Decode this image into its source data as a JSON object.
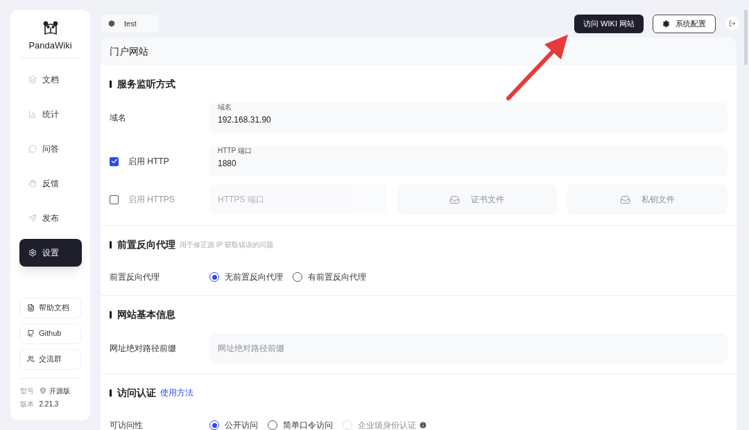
{
  "sidebar": {
    "logo": "PandaWiki",
    "nav": [
      {
        "label": "文档",
        "selected": false
      },
      {
        "label": "统计",
        "selected": false
      },
      {
        "label": "问答",
        "selected": false
      },
      {
        "label": "反馈",
        "selected": false
      },
      {
        "label": "发布",
        "selected": false
      },
      {
        "label": "设置",
        "selected": true
      }
    ],
    "links": [
      {
        "label": "帮助文档"
      },
      {
        "label": "Github"
      },
      {
        "label": "交流群"
      }
    ],
    "info": [
      {
        "label": "型号",
        "value": "开源版"
      },
      {
        "label": "版本",
        "value": "2.21.3"
      }
    ]
  },
  "topbar": {
    "workspace": "test",
    "buttons": [
      {
        "label": "访问 WIKI 网站",
        "kind": "primary"
      },
      {
        "label": "系统配置",
        "kind": "outline"
      }
    ]
  },
  "page": {
    "title": "门户网站",
    "sections": [
      {
        "title": "服务监听方式",
        "rows": [
          {
            "kind": "field",
            "label": "域名",
            "fields": [
              {
                "kind": "input",
                "floating_label": "域名",
                "value": "192.168.31.90"
              }
            ]
          },
          {
            "kind": "checkbox",
            "label": "启用 HTTP",
            "checked": true,
            "fields": [
              {
                "kind": "input",
                "floating_label": "HTTP 端口",
                "value": "1880"
              }
            ]
          },
          {
            "kind": "checkbox",
            "label": "启用 HTTPS",
            "checked": false,
            "fields": [
              {
                "kind": "input",
                "placeholder": "HTTPS 端口"
              },
              {
                "kind": "upload",
                "label": "证书文件"
              },
              {
                "kind": "upload",
                "label": "私钥文件"
              }
            ]
          }
        ]
      },
      {
        "title": "前置反向代理",
        "subtitle": "用于修正源 IP 获取错误的问题",
        "rows": [
          {
            "kind": "radio",
            "label": "前置反向代理",
            "options": [
              {
                "label": "无前置反向代理",
                "selected": true,
                "disabled": false
              },
              {
                "label": "有前置反向代理",
                "selected": false,
                "disabled": false
              }
            ]
          }
        ]
      },
      {
        "title": "网站基本信息",
        "rows": [
          {
            "kind": "field",
            "label": "网址绝对路径前缀",
            "fields": [
              {
                "kind": "input",
                "placeholder": "网址绝对路径前缀"
              }
            ]
          }
        ]
      },
      {
        "title": "访问认证",
        "link": "使用方法",
        "rows": [
          {
            "kind": "radio",
            "label": "可访问性",
            "options": [
              {
                "label": "公开访问",
                "selected": true,
                "disabled": false
              },
              {
                "label": "简单口令访问",
                "selected": false,
                "disabled": false
              },
              {
                "label": "企业级身份认证",
                "selected": false,
                "disabled": true,
                "info": true
              }
            ]
          }
        ]
      }
    ]
  }
}
